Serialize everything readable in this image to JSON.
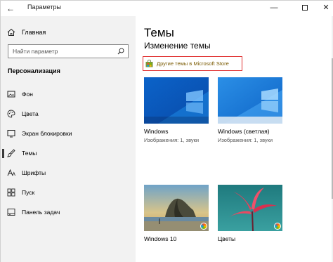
{
  "window": {
    "title": "Параметры",
    "back_glyph": "←",
    "minimize_glyph": "—",
    "close_glyph": "✕"
  },
  "sidebar": {
    "home_label": "Главная",
    "search_placeholder": "Найти параметр",
    "section_title": "Персонализация",
    "items": [
      {
        "label": "Фон",
        "icon": "picture-icon"
      },
      {
        "label": "Цвета",
        "icon": "palette-icon"
      },
      {
        "label": "Экран блокировки",
        "icon": "lock-screen-icon"
      },
      {
        "label": "Темы",
        "icon": "brush-icon",
        "selected": true
      },
      {
        "label": "Шрифты",
        "icon": "font-icon"
      },
      {
        "label": "Пуск",
        "icon": "start-icon"
      },
      {
        "label": "Панель задач",
        "icon": "taskbar-icon"
      }
    ]
  },
  "main": {
    "title": "Темы",
    "subtitle": "Изменение темы",
    "store_link": "Другие темы в Microsoft Store",
    "themes": [
      {
        "name": "Windows",
        "desc": "Изображения: 1, звуки",
        "style": "windows"
      },
      {
        "name": "Windows (светлая)",
        "desc": "Изображения: 1, звуки",
        "style": "windows-light"
      },
      {
        "name": "Windows 10",
        "desc": "",
        "style": "beach"
      },
      {
        "name": "Цветы",
        "desc": "",
        "style": "flowers"
      }
    ]
  },
  "colors": {
    "accent_red": "#e03030",
    "windows_blue": "#0078d7",
    "sidebar_bg": "#f2f2f2"
  }
}
